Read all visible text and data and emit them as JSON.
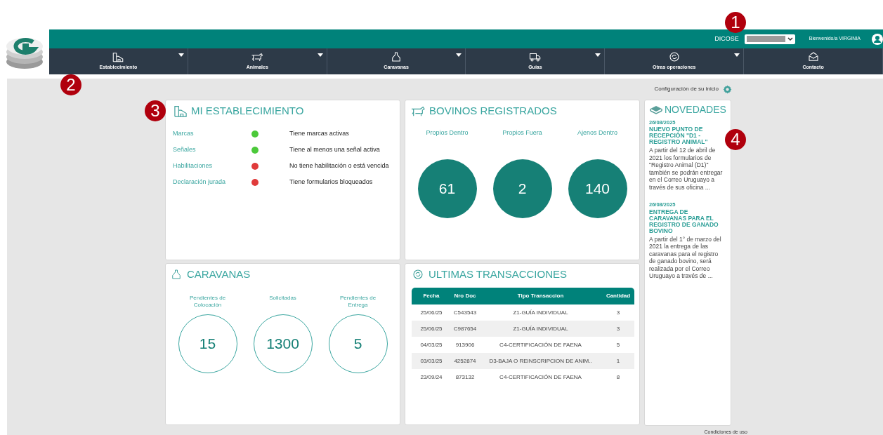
{
  "header": {
    "dicose_label": "DICOSE",
    "welcome": "Bienvenido/a VIRGINIA"
  },
  "nav": [
    {
      "label": "Establecimiento",
      "has_menu": true
    },
    {
      "label": "Animales",
      "has_menu": true
    },
    {
      "label": "Caravanas",
      "has_menu": true
    },
    {
      "label": "Guías",
      "has_menu": true
    },
    {
      "label": "Otras operaciones",
      "has_menu": true
    },
    {
      "label": "Contacto",
      "has_menu": false
    }
  ],
  "config_link": "Configuración de su inicio",
  "establecimiento": {
    "title": "MI ESTABLECIMIENTO",
    "items": [
      {
        "name": "Marcas",
        "color": "#4cc93a",
        "status": "Tiene marcas activas"
      },
      {
        "name": "Señales",
        "color": "#4cc93a",
        "status": "Tiene al menos una señal activa"
      },
      {
        "name": "Habilitaciones",
        "color": "#e03b3b",
        "status": "No tiene habilitación o está vencida"
      },
      {
        "name": "Declaración jurada",
        "color": "#e03b3b",
        "status": "Tiene formularios bloqueados"
      }
    ]
  },
  "bovinos": {
    "title": "BOVINOS REGISTRADOS",
    "stats": [
      {
        "label": "Propios Dentro",
        "value": "61"
      },
      {
        "label": "Propios Fuera",
        "value": "2"
      },
      {
        "label": "Ajenos Dentro",
        "value": "140"
      }
    ]
  },
  "novedades": {
    "title": "NOVEDADES",
    "items": [
      {
        "date": "26/08/2025",
        "headline": "NUEVO PUNTO DE RECEPCIÓN \"D1 - REGISTRO ANIMAL\"",
        "body": "A partir del 12 de abril de 2021 los formularios de \"Registro Animal (D1)\" también se podrán entregar en el Correo Uruguayo a través de sus oficina ..."
      },
      {
        "date": "26/08/2025",
        "headline": "ENTREGA DE CARAVANAS PARA EL REGISTRO DE GANADO BOVINO",
        "body": "A partir del 1° de marzo del 2021 la entrega de las caravanas para el registro de ganado bovino, será realizada por el Correo Uruguayo a través de ..."
      }
    ]
  },
  "caravanas": {
    "title": "CARAVANAS",
    "stats": [
      {
        "label": "Pendientes de Colocación",
        "value": "15"
      },
      {
        "label": "Solicitadas",
        "value": "1300"
      },
      {
        "label": "Pendientes de Entrega",
        "value": "5"
      }
    ]
  },
  "transacciones": {
    "title": "ULTIMAS TRANSACCIONES",
    "columns": [
      "Fecha",
      "Nro Doc",
      "Tipo Transaccion",
      "Cantidad"
    ],
    "rows": [
      [
        "25/06/25",
        "C543543",
        "Z1-GUÍA INDIVIDUAL",
        "3"
      ],
      [
        "25/06/25",
        "C987654",
        "Z1-GUÍA INDIVIDUAL",
        "3"
      ],
      [
        "04/03/25",
        "913906",
        "C4-CERTIFICACIÓN DE FAENA",
        "5"
      ],
      [
        "03/03/25",
        "4252874",
        "D3-BAJA O REINSCRIPCION DE ANIM..",
        "1"
      ],
      [
        "23/09/24",
        "873132",
        "C4-CERTIFICACIÓN DE FAENA",
        "8"
      ]
    ]
  },
  "footer_link": "Condiciones de uso",
  "callouts": [
    "1",
    "2",
    "3",
    "4"
  ]
}
